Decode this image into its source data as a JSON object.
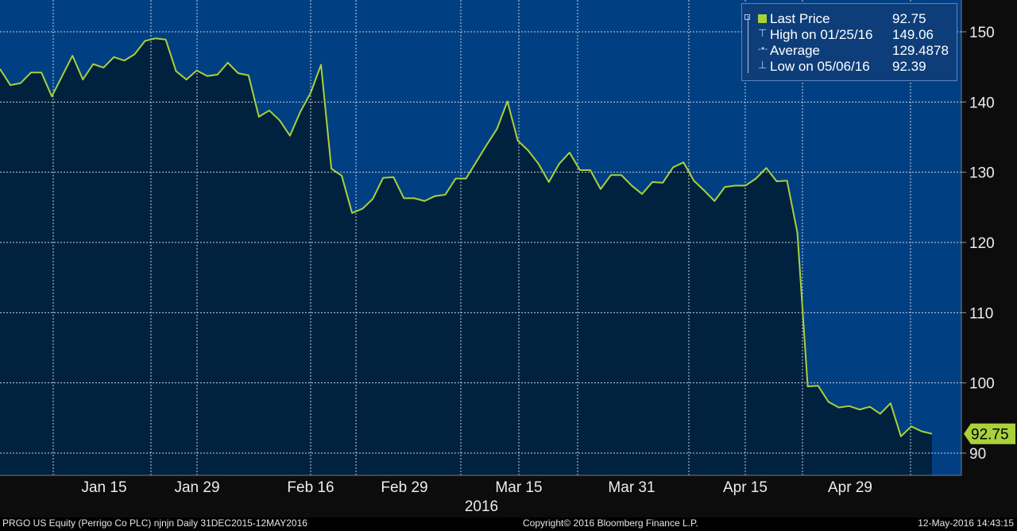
{
  "chart_data": {
    "type": "area",
    "ylim": [
      86,
      154
    ],
    "yticks": [
      90,
      100,
      110,
      120,
      130,
      140,
      150
    ],
    "xtick_labels": [
      "Jan 15",
      "Jan 29",
      "Feb 16",
      "Feb 29",
      "Mar 15",
      "Mar 31",
      "Apr 15",
      "Apr 29"
    ],
    "x_sublabel": "2016",
    "series": [
      {
        "name": "Last Price",
        "color": "#a8d13a",
        "values": [
          144.7,
          142.4,
          142.7,
          144.2,
          144.2,
          140.8,
          143.7,
          146.6,
          143.2,
          145.4,
          144.9,
          146.4,
          145.9,
          146.8,
          148.7,
          149.06,
          148.9,
          144.4,
          143.2,
          144.5,
          143.7,
          143.9,
          145.6,
          144.1,
          143.8,
          137.9,
          138.8,
          137.4,
          135.2,
          138.6,
          141.3,
          145.3,
          130.5,
          129.5,
          124.2,
          124.8,
          126.2,
          129.2,
          129.3,
          126.3,
          126.3,
          125.9,
          126.6,
          126.8,
          129.1,
          129.1,
          131.5,
          133.9,
          136.2,
          140.1,
          134.5,
          133.1,
          131.2,
          128.6,
          131.2,
          132.8,
          130.3,
          130.3,
          127.6,
          129.6,
          129.6,
          128.1,
          126.9,
          128.6,
          128.5,
          130.7,
          131.4,
          128.8,
          127.4,
          125.9,
          127.9,
          128.1,
          128.1,
          129.1,
          130.6,
          128.7,
          128.8,
          121.4,
          99.5,
          99.6,
          97.3,
          96.5,
          96.7,
          96.2,
          96.6,
          95.6,
          97.1,
          92.39,
          93.8,
          93.1,
          92.75
        ]
      }
    ],
    "last_value_label": "92.75",
    "legend": {
      "rows": [
        {
          "label": "Last Price",
          "value": "92.75"
        },
        {
          "label": "High on 01/25/16",
          "value": "149.06"
        },
        {
          "label": "Average",
          "value": "129.4878"
        },
        {
          "label": "Low on 05/06/16",
          "value": "92.39"
        }
      ]
    }
  },
  "footer": {
    "left": "PRGO US Equity (Perrigo Co PLC) njnjn  Daily 31DEC2015-12MAY2016",
    "center": "Copyright© 2016 Bloomberg Finance L.P.",
    "right": "12-May-2016 14:43:15"
  },
  "colors": {
    "background": "#003f82",
    "area_fill": "#00223f",
    "line": "#a8d13a",
    "grid": "#c9d3e0"
  }
}
